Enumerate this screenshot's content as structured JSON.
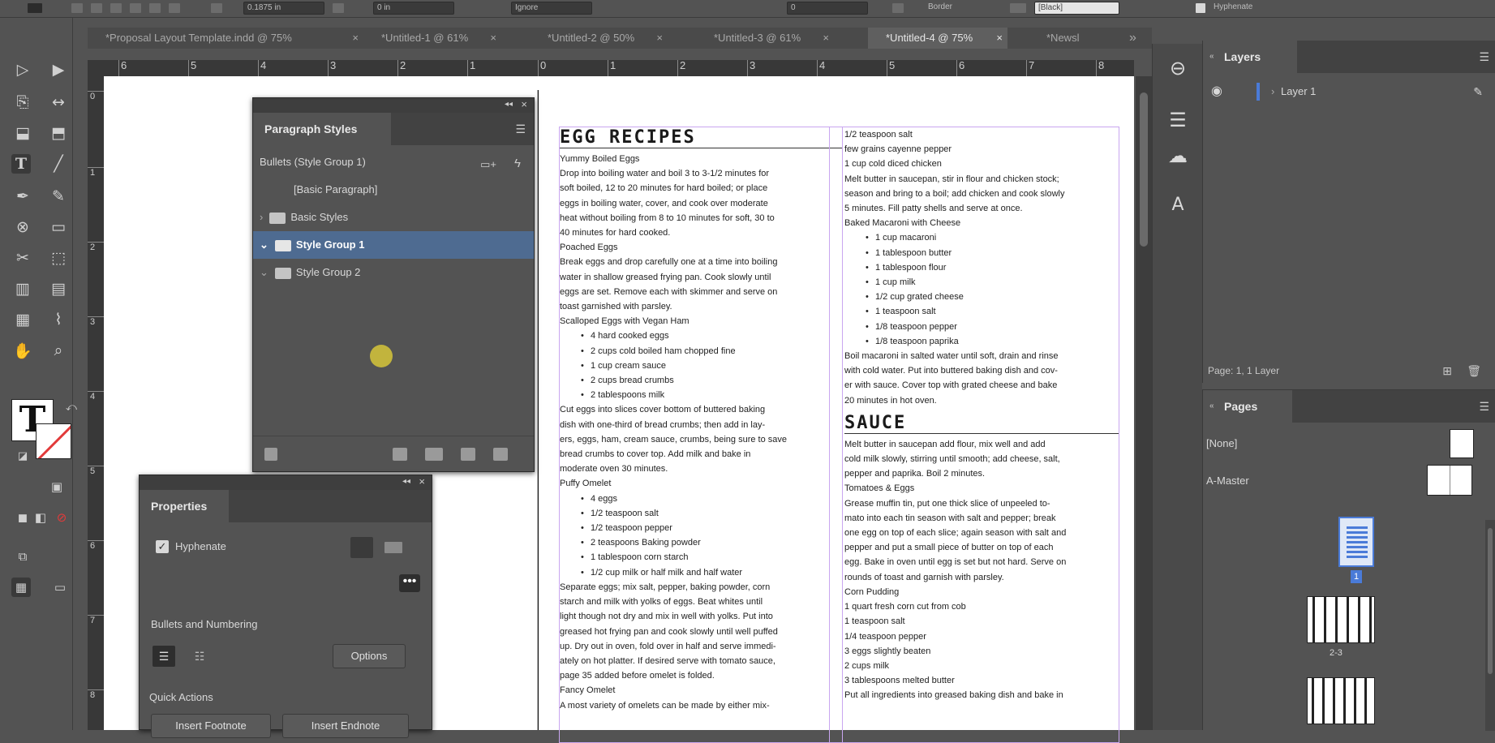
{
  "top_controls": {
    "field1": "0.1875 in",
    "field2": "0 in",
    "field3": "Ignore",
    "field4": "0",
    "field5": "Border",
    "field6": "[Black]",
    "hyphenate_label": "Hyphenate"
  },
  "tabs": [
    {
      "label": "*Proposal Layout Template.indd @ 75%"
    },
    {
      "label": "*Untitled-1 @ 61%"
    },
    {
      "label": "*Untitled-2 @ 50%"
    },
    {
      "label": "*Untitled-3 @ 61%"
    },
    {
      "label": "*Untitled-4 @ 75%",
      "active": true
    },
    {
      "label": "*Newsl"
    }
  ],
  "tab_overflow": "»",
  "ruler_h": [
    "6",
    "5",
    "4",
    "3",
    "2",
    "1",
    "0",
    "1",
    "2",
    "3",
    "4",
    "5",
    "6",
    "7",
    "8"
  ],
  "ruler_v": [
    "0",
    "1",
    "2",
    "3",
    "4",
    "5",
    "6",
    "7",
    "8"
  ],
  "paragraph_styles": {
    "title": "Paragraph Styles",
    "active_group": "Bullets (Style Group 1)",
    "items": [
      {
        "label": "[Basic Paragraph]",
        "indent": 2
      },
      {
        "label": "Basic Styles",
        "folder": true
      },
      {
        "label": "Style Group 1",
        "folder": true,
        "selected": true
      },
      {
        "label": "Style Group 2",
        "folder": true
      }
    ]
  },
  "properties": {
    "title": "Properties",
    "hyphenate": "Hyphenate",
    "bullets_heading": "Bullets and Numbering",
    "options": "Options",
    "quick_actions": "Quick Actions",
    "btn1": "Insert Footnote",
    "btn2": "Insert Endnote"
  },
  "layers": {
    "title": "Layers",
    "layer_name": "Layer 1",
    "footer": "Page: 1, 1 Layer"
  },
  "pages": {
    "title": "Pages",
    "none": "[None]",
    "master": "A-Master",
    "page1": "1",
    "spread": "2-3"
  },
  "document": {
    "col1_title": "EGG RECIPES",
    "col1": [
      {
        "t": "Yummy Boiled Eggs"
      },
      {
        "t": "Drop into boiling water and boil 3 to 3-1/2 minutes for"
      },
      {
        "t": "soft boiled, 12 to 20 minutes for hard boiled; or place"
      },
      {
        "t": "eggs in boiling water, cover, and cook over moderate"
      },
      {
        "t": "heat without boiling from 8 to 10 minutes for soft, 30 to"
      },
      {
        "t": "40 minutes for hard cooked."
      },
      {
        "t": "Poached Eggs"
      },
      {
        "t": "Break eggs and drop carefully one at a time into boiling"
      },
      {
        "t": "water in shallow greased frying pan. Cook slowly until"
      },
      {
        "t": "eggs are set. Remove each with skimmer and serve on"
      },
      {
        "t": "toast garnished with parsley."
      },
      {
        "t": "Scalloped Eggs with Vegan Ham"
      },
      {
        "t": "4 hard cooked eggs",
        "b": true
      },
      {
        "t": "2 cups cold boiled ham chopped fine",
        "b": true
      },
      {
        "t": "1 cup cream sauce",
        "b": true
      },
      {
        "t": "2 cups bread crumbs",
        "b": true
      },
      {
        "t": "2 tablespoons milk",
        "b": true
      },
      {
        "t": "Cut eggs into slices cover bottom of buttered baking"
      },
      {
        "t": "dish with one-third of bread crumbs; then add in lay-"
      },
      {
        "t": "ers, eggs, ham, cream sauce, crumbs, being sure to save"
      },
      {
        "t": "bread crumbs to cover top. Add milk and bake in"
      },
      {
        "t": "moderate oven 30 minutes."
      },
      {
        "t": "Puffy Omelet"
      },
      {
        "t": "4 eggs",
        "b": true
      },
      {
        "t": "1/2 teaspoon salt",
        "b": true
      },
      {
        "t": "1/2 teaspoon pepper",
        "b": true
      },
      {
        "t": "2 teaspoons Baking powder",
        "b": true
      },
      {
        "t": "1 tablespoon corn starch",
        "b": true
      },
      {
        "t": "1/2 cup milk or half milk and half water",
        "b": true
      },
      {
        "t": "Separate eggs; mix salt, pepper, baking powder, corn"
      },
      {
        "t": "starch and milk with yolks of eggs. Beat whites until"
      },
      {
        "t": "light though not dry and mix in well with yolks. Put into"
      },
      {
        "t": "greased hot frying pan and cook slowly until well puffed"
      },
      {
        "t": "up. Dry out in oven, fold over in half and serve immedi-"
      },
      {
        "t": "ately on hot platter. If desired serve with tomato sauce,"
      },
      {
        "t": "page 35 added before omelet is folded."
      },
      {
        "t": "Fancy Omelet"
      },
      {
        "t": "A most variety of omelets can be made by either mix-"
      }
    ],
    "col2a": [
      {
        "t": "1/2 teaspoon salt"
      },
      {
        "t": "few grains cayenne pepper"
      },
      {
        "t": "1 cup cold diced chicken"
      },
      {
        "t": "Melt butter in saucepan, stir in flour and chicken stock;"
      },
      {
        "t": "season and bring to a boil; add chicken and cook slowly"
      },
      {
        "t": "5 minutes. Fill patty shells and serve at once."
      },
      {
        "t": "Baked Macaroni with Cheese"
      },
      {
        "t": "1 cup macaroni",
        "b": true
      },
      {
        "t": "1 tablespoon butter",
        "b": true
      },
      {
        "t": "1 tablespoon flour",
        "b": true
      },
      {
        "t": "1 cup milk",
        "b": true
      },
      {
        "t": "1/2 cup grated cheese",
        "b": true
      },
      {
        "t": "1 teaspoon salt",
        "b": true
      },
      {
        "t": "1/8 teaspoon pepper",
        "b": true
      },
      {
        "t": "1/8 teaspoon paprika",
        "b": true
      },
      {
        "t": "Boil macaroni in salted water until soft, drain and rinse"
      },
      {
        "t": "with cold water. Put into buttered baking dish and cov-"
      },
      {
        "t": "er with sauce. Cover top with grated cheese and bake"
      },
      {
        "t": "20 minutes in hot oven."
      }
    ],
    "col2_title": "SAUCE",
    "col2b": [
      {
        "t": "Melt butter in saucepan add flour, mix well and add"
      },
      {
        "t": "cold milk slowly, stirring until smooth; add cheese, salt,"
      },
      {
        "t": "pepper and paprika. Boil 2 minutes."
      },
      {
        "t": "Tomatoes & Eggs"
      },
      {
        "t": "Grease muffin tin, put one thick slice of unpeeled to-"
      },
      {
        "t": "mato into each tin season with salt and pepper; break"
      },
      {
        "t": "one egg on top of each slice; again season with salt and"
      },
      {
        "t": "pepper and put a small piece of butter on top of each"
      },
      {
        "t": "egg. Bake in oven until egg is set but not hard. Serve on"
      },
      {
        "t": "rounds of toast and garnish with parsley."
      },
      {
        "t": "Corn Pudding"
      },
      {
        "t": "1 quart fresh corn cut from cob"
      },
      {
        "t": "1 teaspoon salt"
      },
      {
        "t": "1/4 teaspoon pepper"
      },
      {
        "t": "3 eggs slightly beaten"
      },
      {
        "t": "2 cups milk"
      },
      {
        "t": "3 tablespoons melted butter"
      },
      {
        "t": "Put all ingredients into greased baking dish and bake in"
      }
    ]
  }
}
